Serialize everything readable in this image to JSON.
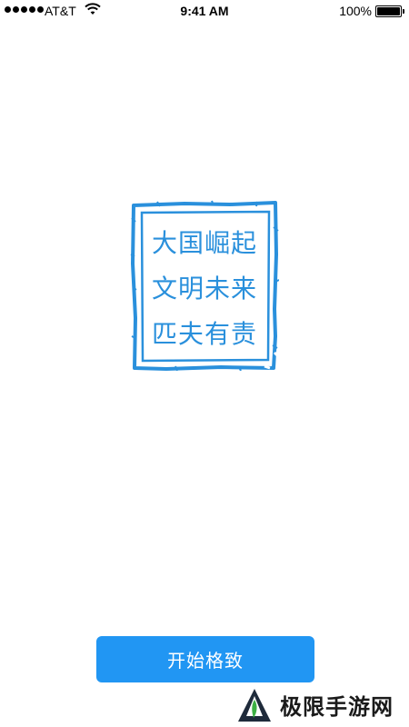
{
  "status_bar": {
    "carrier": "AT&T",
    "time": "9:41 AM",
    "battery": "100%"
  },
  "stamp": {
    "lines": [
      "大国崛起",
      "文明未来",
      "匹夫有责"
    ],
    "color": "#2a90dc"
  },
  "start_button": {
    "label": "开始格致",
    "color": "#2196f3"
  },
  "watermark": {
    "text": "极限手游网"
  }
}
